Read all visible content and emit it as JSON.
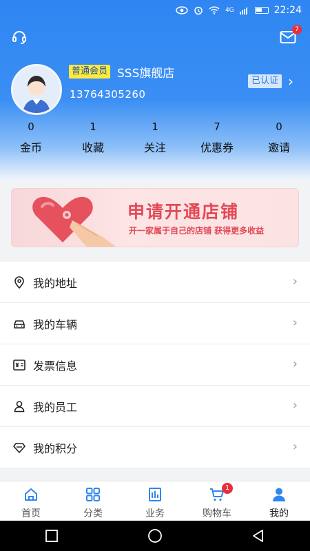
{
  "status_bar": {
    "time": "22:24",
    "signal": "4G",
    "signal_sub": "ull"
  },
  "header": {
    "mail_badge": "7",
    "member_level": "普通会员",
    "shop_name": "SSS旗舰店",
    "phone": "13764305260",
    "verified": "已认证",
    "chevron": "›"
  },
  "stats": [
    {
      "value": "0",
      "label": "金币"
    },
    {
      "value": "1",
      "label": "收藏"
    },
    {
      "value": "1",
      "label": "关注"
    },
    {
      "value": "7",
      "label": "优惠券"
    },
    {
      "value": "0",
      "label": "邀请"
    }
  ],
  "banner": {
    "title": "申请开通店铺",
    "subtitle": "开一家属于自己的店铺  获得更多收益"
  },
  "menu": [
    {
      "label": "我的地址",
      "icon": "location-pin-icon"
    },
    {
      "label": "我的车辆",
      "icon": "car-icon"
    },
    {
      "label": "发票信息",
      "icon": "invoice-icon"
    },
    {
      "label": "我的员工",
      "icon": "person-icon"
    },
    {
      "label": "我的积分",
      "icon": "diamond-icon"
    }
  ],
  "menu_chevron": "›",
  "tabs": [
    {
      "label": "首页",
      "icon": "home-icon"
    },
    {
      "label": "分类",
      "icon": "grid-icon"
    },
    {
      "label": "业务",
      "icon": "building-icon"
    },
    {
      "label": "购物车",
      "icon": "cart-icon",
      "badge": "1"
    },
    {
      "label": "我的",
      "icon": "user-icon",
      "active": true
    }
  ],
  "colors": {
    "primary": "#2f86f2",
    "accent_red": "#e34a57",
    "badge_red": "#e8303a",
    "member_yellow": "#ffe93c"
  }
}
